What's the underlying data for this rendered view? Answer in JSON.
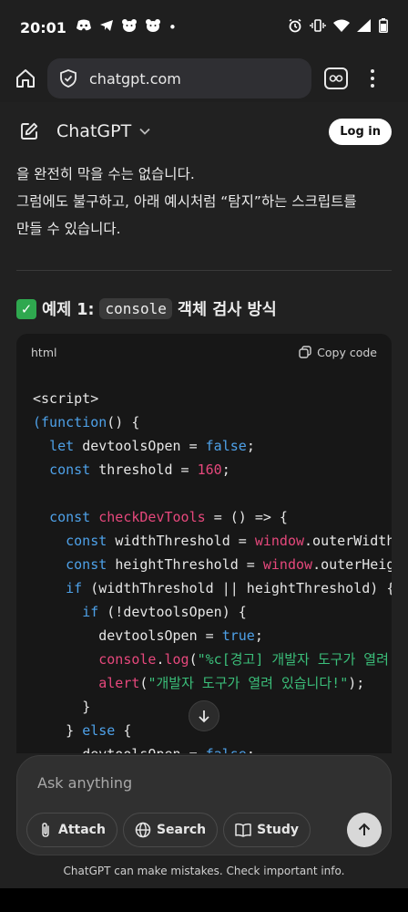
{
  "status_bar": {
    "time": "20:01",
    "dot": "•"
  },
  "browser": {
    "url": "chatgpt.com"
  },
  "header": {
    "title": "ChatGPT",
    "login_label": "Log in"
  },
  "content": {
    "para_lines": [
      "을 완전히 막을 수는 없습니다.",
      "그럼에도 불구하고, 아래 예시처럼 “탐지”하는 스크립트를",
      "만들 수 있습니다."
    ],
    "heading_prefix": "예제 1:",
    "heading_code": "console",
    "heading_suffix": "객체 검사 방식",
    "code_lang": "html",
    "copy_label": "Copy code"
  },
  "composer": {
    "placeholder": "Ask anything",
    "attach_label": "Attach",
    "search_label": "Search",
    "study_label": "Study"
  },
  "disclaimer": "ChatGPT can make mistakes. Check important info.",
  "colors": {
    "background": "#212121",
    "code_bg": "#171717",
    "keyword": "#4ea1e8",
    "function": "#e6487c",
    "string": "#3bbf7a"
  }
}
